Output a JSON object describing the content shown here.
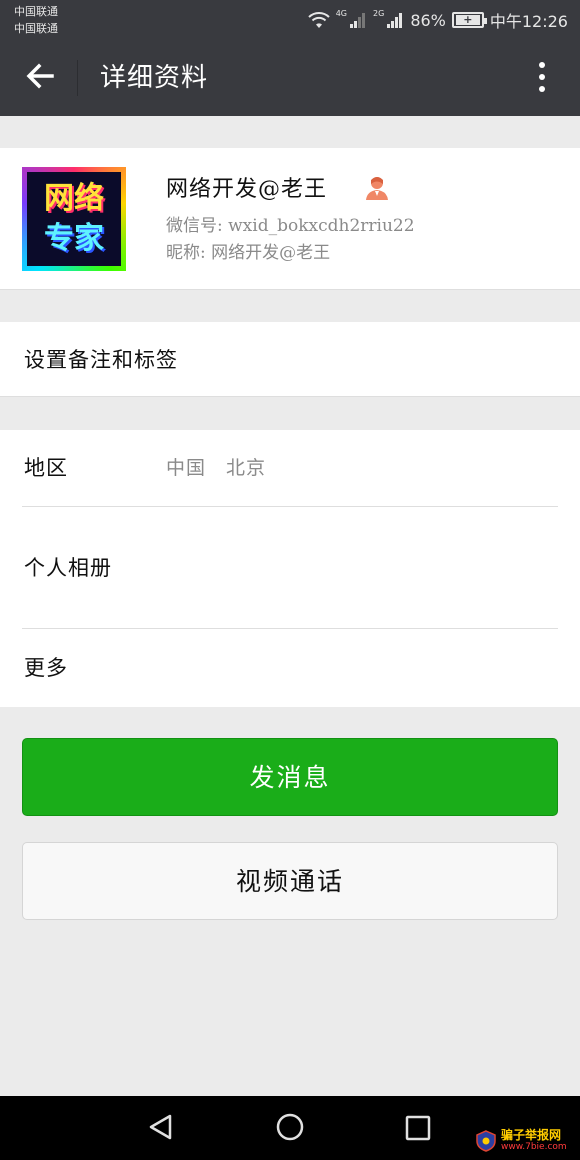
{
  "status_bar": {
    "carrier_1": "中国联通",
    "carrier_2": "中国联通",
    "network_1": "4G",
    "network_2": "2G",
    "battery": "86%",
    "time": "中午12:26"
  },
  "header": {
    "title": "详细资料"
  },
  "profile": {
    "avatar_line_1": "网络",
    "avatar_line_2": "专家",
    "name": "网络开发@老王",
    "wechat_id": "微信号: wxid_bokxcdh2rriu22",
    "nickname": "昵称: 网络开发@老王"
  },
  "cells": {
    "remark_label": "设置备注和标签",
    "region_label": "地区",
    "region_value": "中国　北京",
    "album_label": "个人相册",
    "more_label": "更多"
  },
  "buttons": {
    "send_message": "发消息",
    "video_call": "视频通话"
  },
  "watermark": {
    "main": "骗子举报网",
    "url": "www.7bie.com"
  },
  "colors": {
    "header_bg": "#393a3f",
    "primary_green": "#1aad19",
    "page_bg": "#ebebeb"
  }
}
